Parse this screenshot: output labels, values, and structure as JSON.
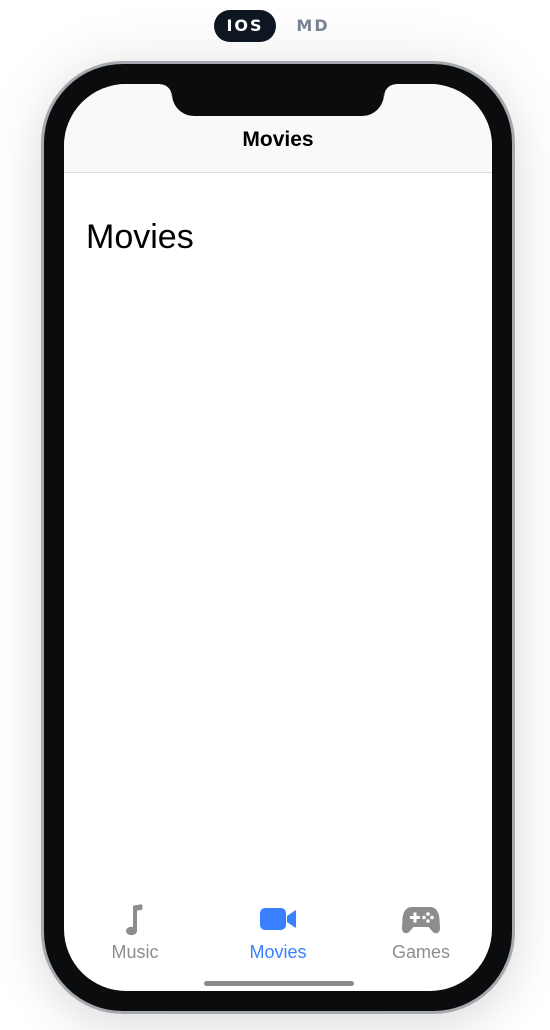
{
  "platform_toggle": {
    "ios_label": "IOS",
    "md_label": "MD",
    "selected": "IOS"
  },
  "toolbar": {
    "title": "Movies"
  },
  "content": {
    "title": "Movies"
  },
  "tabs": [
    {
      "label": "Music",
      "icon": "music-note-icon",
      "selected": false
    },
    {
      "label": "Movies",
      "icon": "videocam-icon",
      "selected": true
    },
    {
      "label": "Games",
      "icon": "game-controller-icon",
      "selected": false
    }
  ],
  "colors": {
    "accent": "#3880ff",
    "inactive": "#8d8d8d",
    "device_frame": "#0b0c0e",
    "toggle_active_bg": "#0f1722"
  }
}
